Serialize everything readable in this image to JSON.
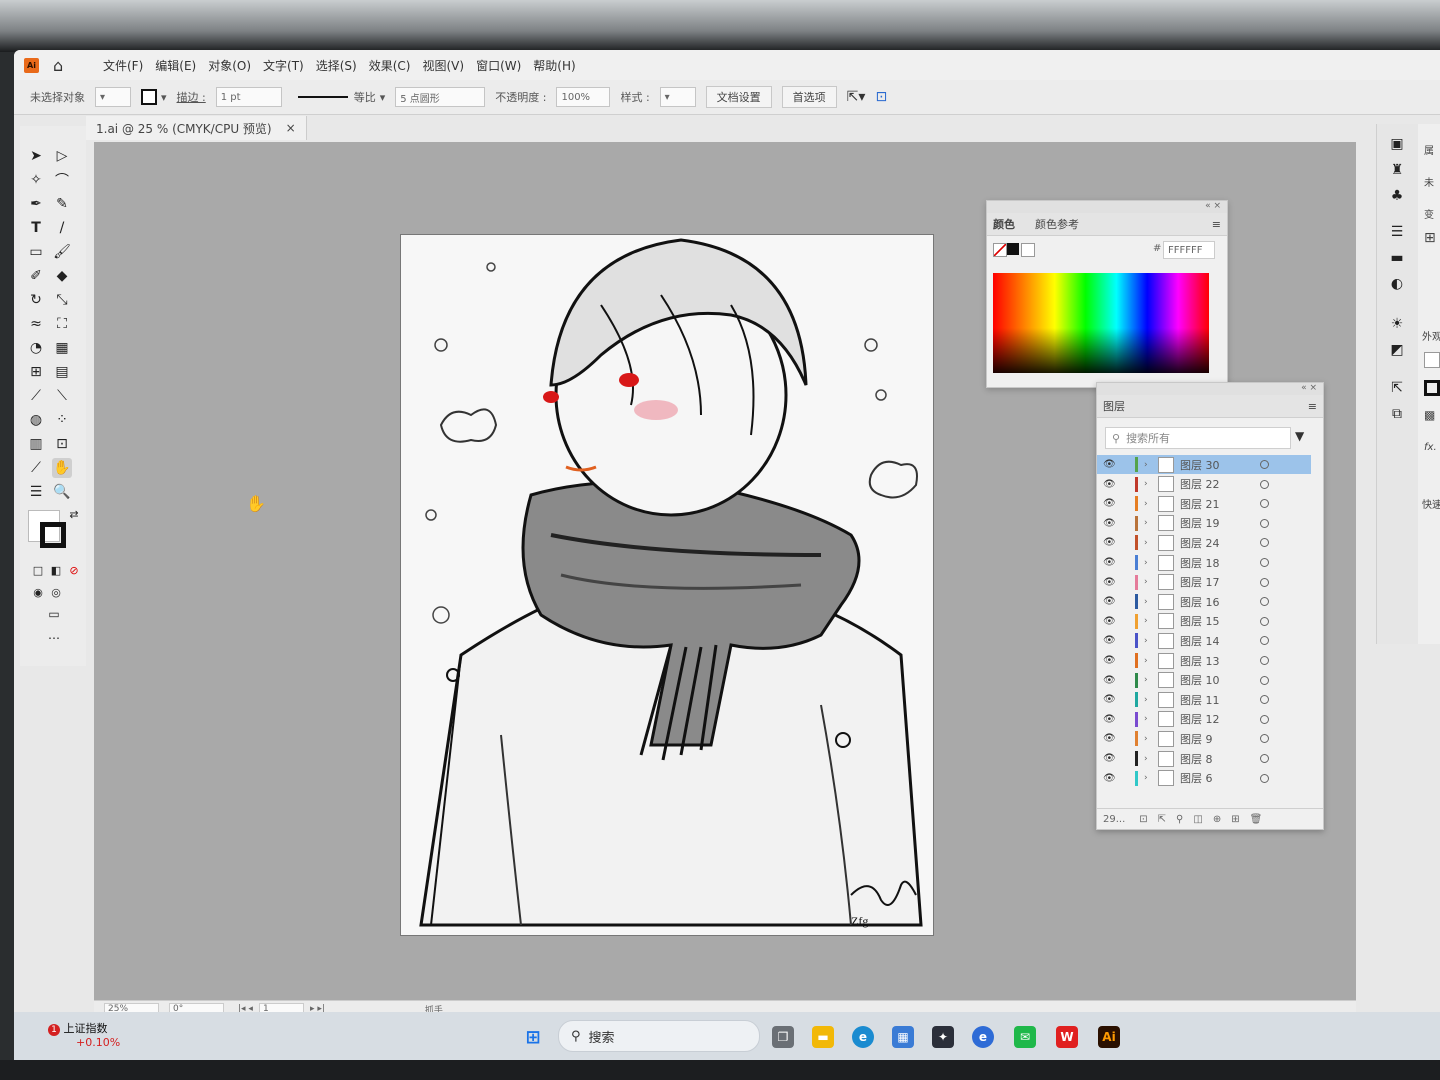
{
  "menubar": {
    "app_badge": "Ai",
    "items": [
      "文件(F)",
      "编辑(E)",
      "对象(O)",
      "文字(T)",
      "选择(S)",
      "效果(C)",
      "视图(V)",
      "窗口(W)",
      "帮助(H)"
    ]
  },
  "controlbar": {
    "selection_status": "未选择对象",
    "stroke_label": "描边 :",
    "stroke_value": "1 pt",
    "stroke_profile": "等比",
    "brush": "5 点圆形",
    "opacity_label": "不透明度 :",
    "opacity_value": "100%",
    "style_label": "样式 :",
    "doc_setup_button": "文档设置",
    "prefs_button": "首选项"
  },
  "document_tab": {
    "title": "1.ai @ 25 % (CMYK/CPU 预览)",
    "close": "×"
  },
  "color_panel": {
    "tab_color": "颜色",
    "tab_guide": "颜色参考",
    "hex_label": "#",
    "hex_value": "FFFFFF"
  },
  "layers_panel": {
    "title": "图层",
    "search_placeholder": "搜索所有",
    "footer_count": "29...",
    "layers": [
      {
        "name": "图层 30",
        "color": "#54a34b",
        "selected": true
      },
      {
        "name": "图层 22",
        "color": "#c0392b",
        "selected": false
      },
      {
        "name": "图层 21",
        "color": "#e67e22",
        "selected": false
      },
      {
        "name": "图层 19",
        "color": "#b9733a",
        "selected": false
      },
      {
        "name": "图层 24",
        "color": "#c2512a",
        "selected": false
      },
      {
        "name": "图层 18",
        "color": "#4a7fd4",
        "selected": false
      },
      {
        "name": "图层 17",
        "color": "#e57b9a",
        "selected": false
      },
      {
        "name": "图层 16",
        "color": "#2c5aa0",
        "selected": false
      },
      {
        "name": "图层 15",
        "color": "#f0a030",
        "selected": false
      },
      {
        "name": "图层 14",
        "color": "#4a53c8",
        "selected": false
      },
      {
        "name": "图层 13",
        "color": "#e07020",
        "selected": false
      },
      {
        "name": "图层 10",
        "color": "#2f8a4a",
        "selected": false
      },
      {
        "name": "图层 11",
        "color": "#1fa8a0",
        "selected": false
      },
      {
        "name": "图层 12",
        "color": "#7a4bd0",
        "selected": false
      },
      {
        "name": "图层 9",
        "color": "#e08030",
        "selected": false
      },
      {
        "name": "图层 8",
        "color": "#222222",
        "selected": false
      },
      {
        "name": "图层 6",
        "color": "#30c8c8",
        "selected": false
      }
    ]
  },
  "right_props": {
    "attr": "属",
    "unsel": "未",
    "transform": "变",
    "appearance": "外观",
    "fx": "fx.",
    "quick": "快速"
  },
  "statusbar": {
    "zoom": "25%",
    "rotation": "0°",
    "artboard": "1",
    "tool": "抓手"
  },
  "taskbar": {
    "stock_name": "上证指数",
    "stock_change": "+0.10%",
    "stock_badge": "1",
    "search_label": "搜索"
  },
  "signature": "Zfg"
}
